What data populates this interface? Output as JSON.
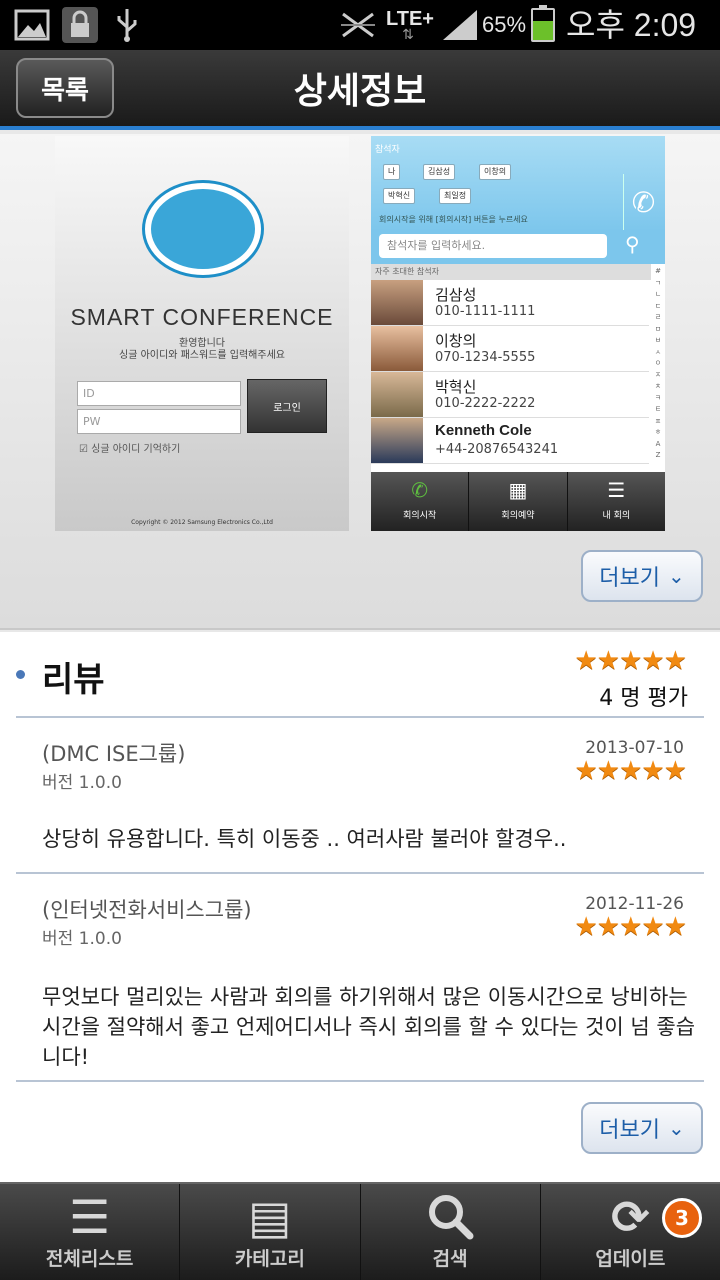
{
  "status_bar": {
    "lte": "LTE+",
    "battery": "65%",
    "battery_level": 0.65,
    "time": "오후 2:09",
    "icons": [
      "image-icon",
      "lock-icon",
      "usb-icon",
      "no-signal-icon",
      "data-arrows-icon",
      "signal-icon",
      "battery-icon"
    ]
  },
  "header": {
    "back_label": "목록",
    "title": "상세정보"
  },
  "screenshots": {
    "login": {
      "app_title": "SMART CONFERENCE",
      "subtitle1": "환영합니다",
      "subtitle2": "싱글 아이디와 패스워드를 입력해주세요",
      "id_placeholder": "ID",
      "pw_placeholder": "PW",
      "login_button": "로그인",
      "remember": "싱글 아이디 기억하기",
      "copyright": "Copyright © 2012 Samsung Electronics Co.,Ltd"
    },
    "contacts": {
      "header_title": "참석자",
      "chips": [
        "나",
        "김삼성",
        "이창의",
        "박혁신",
        "최일정"
      ],
      "hint": "회의시작을 위해 [회의시작] 버튼을 누르세요",
      "search_placeholder": "참석자를 입력하세요.",
      "section": "자주 초대한 참석자",
      "list": [
        {
          "name": "김삼성",
          "phone": "010-1111-1111"
        },
        {
          "name": "이창의",
          "phone": "070-1234-5555"
        },
        {
          "name": "박혁신",
          "phone": "010-2222-2222"
        },
        {
          "name": "Kenneth Cole",
          "phone": "+44-20876543241"
        }
      ],
      "index": [
        "#",
        "ㄱ",
        "ㄴ",
        "ㄷ",
        "ㄹ",
        "ㅁ",
        "ㅂ",
        "ㅅ",
        "ㅇ",
        "ㅈ",
        "ㅊ",
        "ㅋ",
        "ㅌ",
        "ㅍ",
        "ㅎ",
        "A",
        "Z"
      ],
      "tabs": [
        "회의시작",
        "회의예약",
        "내 회의"
      ]
    },
    "more_label": "더보기"
  },
  "reviews": {
    "title": "리뷰",
    "rating": 5,
    "count_text": "4 명 평가",
    "items": [
      {
        "group": "(DMC ISE그룹)",
        "version": "버전 1.0.0",
        "date": "2013-07-10",
        "rating": 5,
        "text": "상당히 유용합니다. 특히 이동중 .. 여러사람 불러야 할경우.."
      },
      {
        "group": "(인터넷전화서비스그룹)",
        "version": "버전 1.0.0",
        "date": "2012-11-26",
        "rating": 5,
        "text": "무엇보다 멀리있는 사람과 회의를 하기위해서 많은 이동시간으로 낭비하는 시간을 절약해서 좋고 언제어디서나 즉시 회의를 할 수 있다는 것이 넘 좋습니다!"
      }
    ],
    "more_label": "더보기"
  },
  "bottom_nav": {
    "items": [
      {
        "label": "전체리스트",
        "icon": "list-icon"
      },
      {
        "label": "카테고리",
        "icon": "category-icon"
      },
      {
        "label": "검색",
        "icon": "search-icon"
      },
      {
        "label": "업데이트",
        "icon": "refresh-icon",
        "badge": "3"
      }
    ]
  },
  "colors": {
    "accent_blue": "#2a7fd0",
    "star_orange": "#f18a12",
    "badge_orange": "#e8620e"
  }
}
